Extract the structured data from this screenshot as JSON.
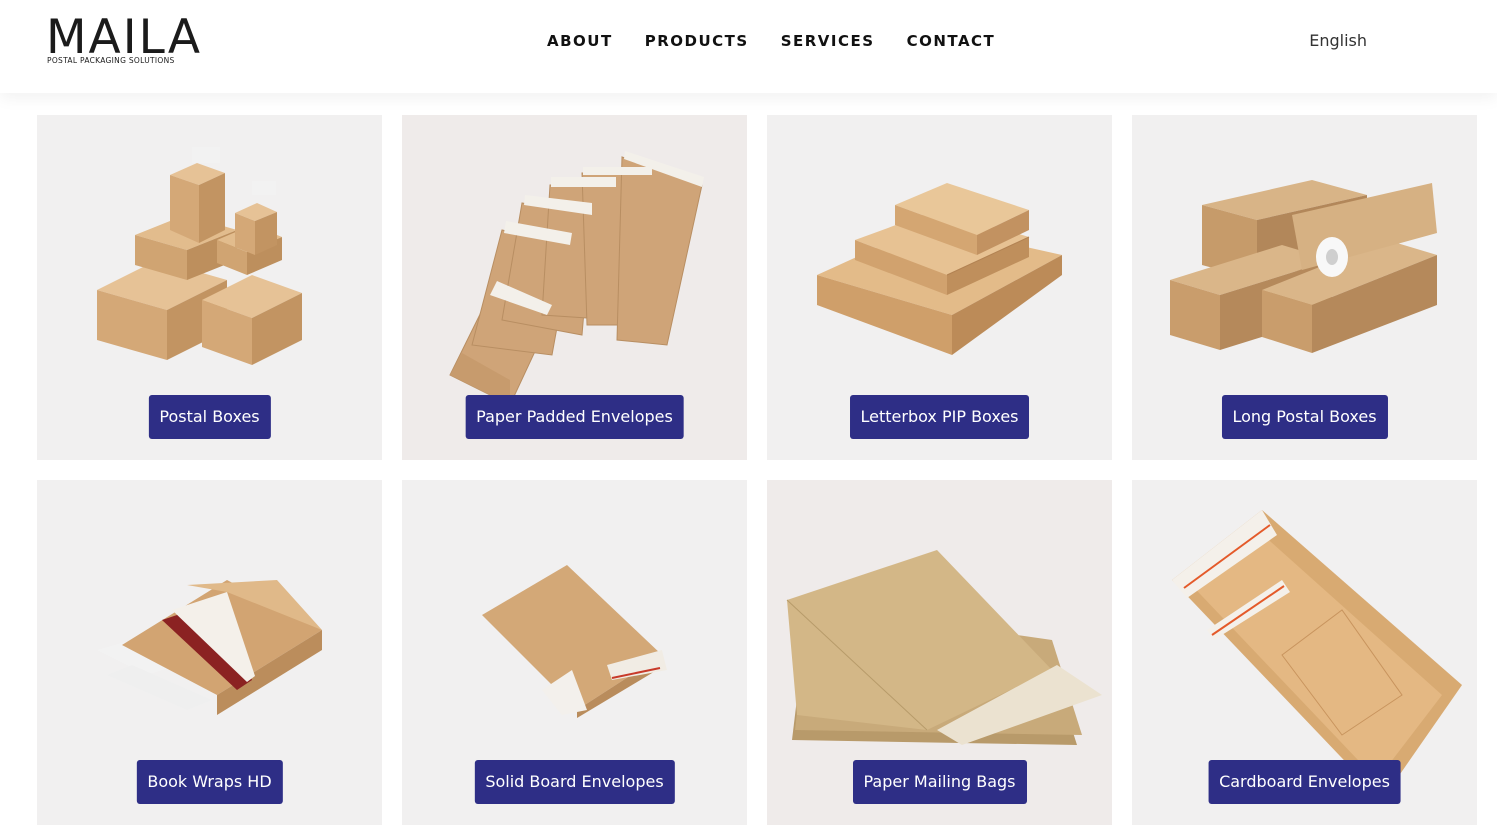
{
  "brand": {
    "name": "MAILA",
    "tagline": "POSTAL PACKAGING SOLUTIONS"
  },
  "nav": [
    {
      "label": "ABOUT"
    },
    {
      "label": "PRODUCTS"
    },
    {
      "label": "SERVICES"
    },
    {
      "label": "CONTACT"
    }
  ],
  "language": "English",
  "products": [
    {
      "label": "Postal Boxes",
      "image": "postal-boxes-image"
    },
    {
      "label": "Paper Padded Envelopes",
      "image": "padded-envelopes-image"
    },
    {
      "label": "Letterbox PIP Boxes",
      "image": "pip-boxes-image"
    },
    {
      "label": "Long Postal Boxes",
      "image": "long-boxes-image"
    },
    {
      "label": "Book Wraps HD",
      "image": "book-wraps-image"
    },
    {
      "label": "Solid Board Envelopes",
      "image": "solid-board-envelope-image"
    },
    {
      "label": "Paper Mailing Bags",
      "image": "mailing-bags-image"
    },
    {
      "label": "Cardboard Envelopes",
      "image": "cardboard-envelopes-image"
    }
  ],
  "colors": {
    "button_bg": "#2e2e86",
    "tile_bg": "#f1f0f0",
    "kraft": "#d4a877"
  }
}
